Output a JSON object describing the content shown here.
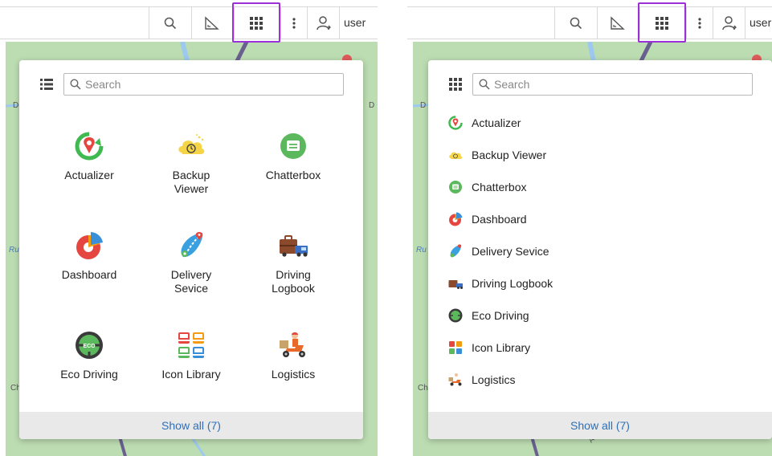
{
  "toolbar": {
    "user_label": "user",
    "icons": [
      "search-icon",
      "measure-icon",
      "apps-grid-icon",
      "more-vertical-icon",
      "user-icon"
    ]
  },
  "launcher": {
    "search_placeholder": "Search",
    "show_all_label": "Show all (7)",
    "apps": [
      {
        "label_line1": "Actualizer",
        "label_line2": "",
        "icon": "actualizer-icon"
      },
      {
        "label_line1": "Backup",
        "label_line2": "Viewer",
        "icon": "backup-viewer-icon"
      },
      {
        "label_line1": "Chatterbox",
        "label_line2": "",
        "icon": "chatterbox-icon"
      },
      {
        "label_line1": "Dashboard",
        "label_line2": "",
        "icon": "dashboard-icon"
      },
      {
        "label_line1": "Delivery",
        "label_line2": "Sevice",
        "icon": "delivery-service-icon"
      },
      {
        "label_line1": "Driving",
        "label_line2": "Logbook",
        "icon": "driving-logbook-icon"
      },
      {
        "label_line1": "Eco Driving",
        "label_line2": "",
        "icon": "eco-driving-icon"
      },
      {
        "label_line1": "Icon Library",
        "label_line2": "",
        "icon": "icon-library-icon"
      },
      {
        "label_line1": "Logistics",
        "label_line2": "",
        "icon": "logistics-icon"
      }
    ],
    "list_items": [
      "Actualizer",
      "Backup Viewer",
      "Chatterbox",
      "Dashboard",
      "Delivery Sevice",
      "Driving Logbook",
      "Eco Driving",
      "Icon Library",
      "Logistics"
    ]
  },
  "map": {
    "labels": [
      "D",
      "D",
      "Ru",
      "Ch",
      "A6"
    ]
  },
  "colors": {
    "highlight": "#9b30d9",
    "link": "#2f6fb7",
    "map_green": "#bcdcb2",
    "map_water": "#9ec9ef",
    "map_road": "#6a6090"
  }
}
